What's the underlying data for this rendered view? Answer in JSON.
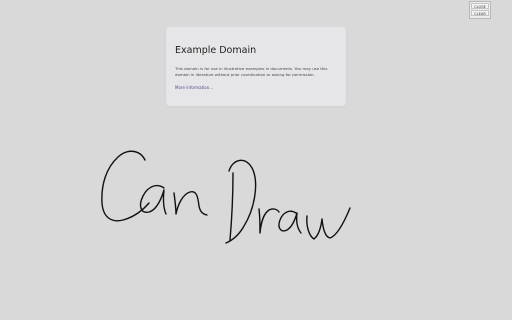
{
  "card": {
    "title": "Example Domain",
    "body": "This domain is for use in illustrative examples in documents. You may use this domain in literature without prior coordination or asking for permission.",
    "link": "More information..."
  },
  "controls": {
    "close_label": "CLOSE",
    "clear_label": "CLEAR"
  },
  "drawing": {
    "stroke_color": "#111111",
    "handwritten_text": "Can Draw"
  },
  "colors": {
    "background": "#d9d9d9",
    "card": "#e6e6e8",
    "link": "#4a4d8c"
  }
}
